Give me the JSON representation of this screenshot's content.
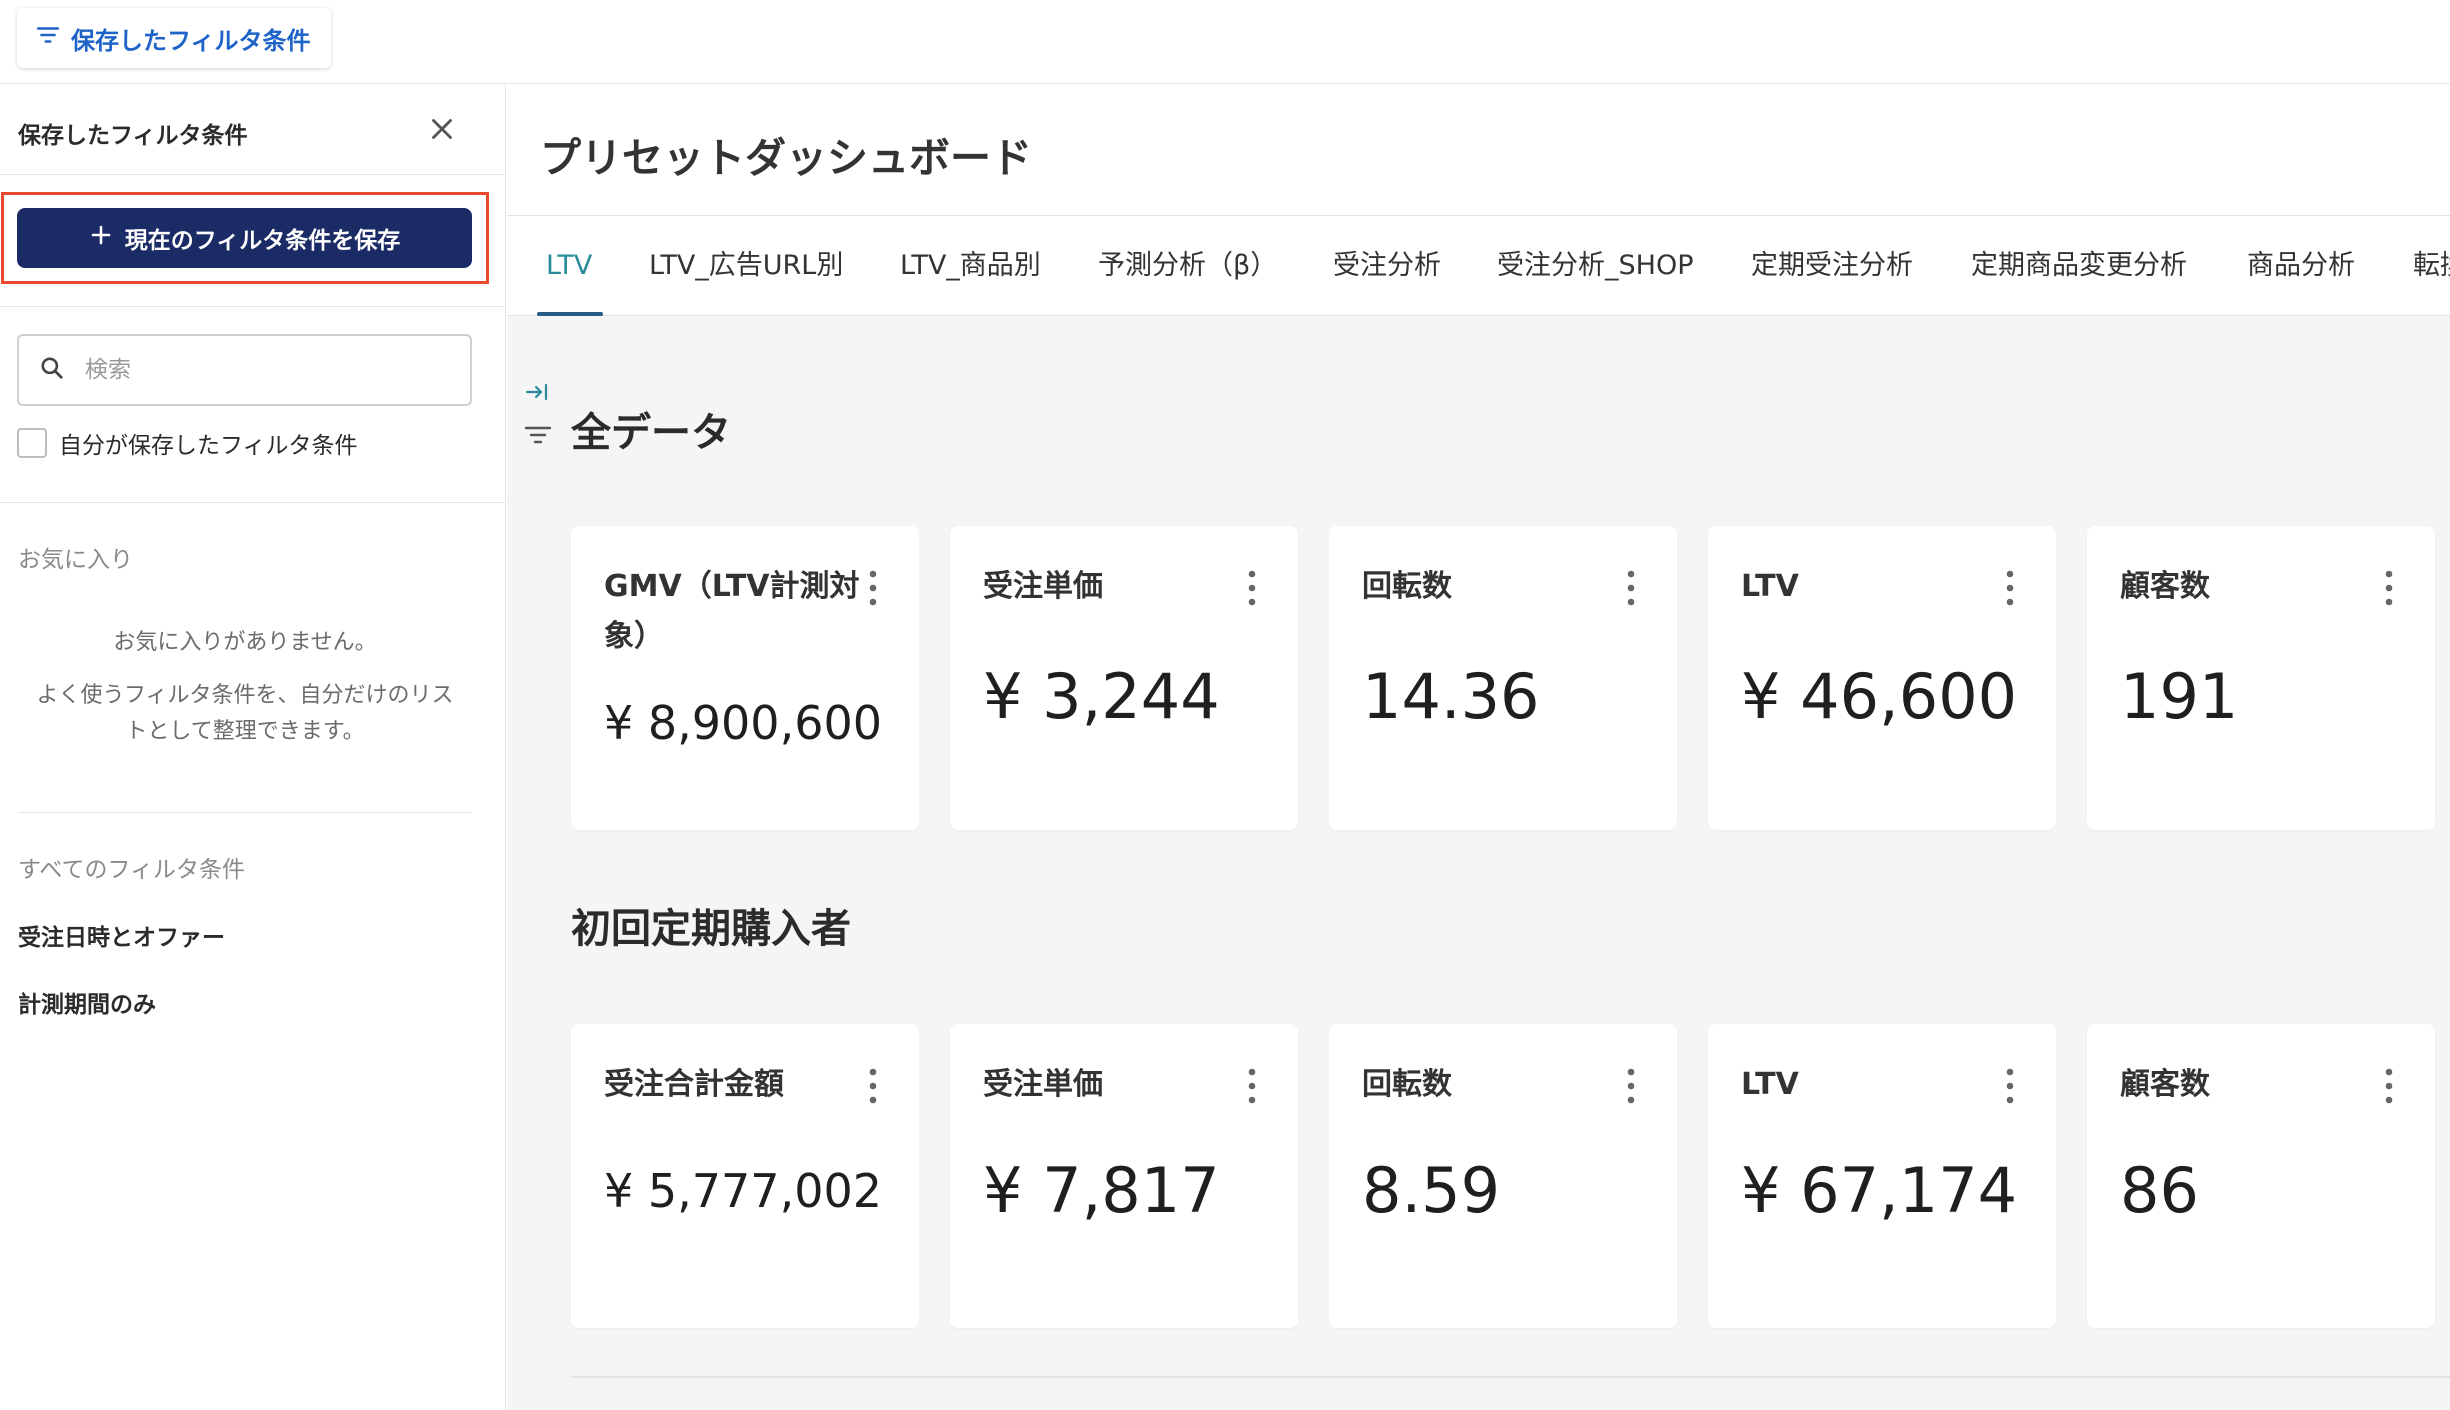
{
  "top_bar": {
    "saved_filters_button": "保存したフィルタ条件"
  },
  "sidebar": {
    "title": "保存したフィルタ条件",
    "save_current_button": "現在のフィルタ条件を保存",
    "search_placeholder": "検索",
    "only_mine_label": "自分が保存したフィルタ条件",
    "favorites_label": "お気に入り",
    "favorites_empty": "お気に入りがありません。",
    "favorites_hint": "よく使うフィルタ条件を、自分だけのリストとして整理できます。",
    "all_filters_label": "すべてのフィルタ条件",
    "filters": [
      "受注日時とオファー",
      "計測期間のみ"
    ]
  },
  "main": {
    "page_title": "プリセットダッシュボード",
    "tabs": [
      "LTV",
      "LTV_広告URL別",
      "LTV_商品別",
      "予測分析（β）",
      "受注分析",
      "受注分析_SHOP",
      "定期受注分析",
      "定期商品変更分析",
      "商品分析",
      "転換"
    ],
    "active_tab": "LTV",
    "sections": [
      {
        "title": "全データ",
        "cards": [
          {
            "title": "GMV（LTV計測対象）",
            "value": "¥ 8,900,600"
          },
          {
            "title": "受注単価",
            "value": "¥ 3,244"
          },
          {
            "title": "回転数",
            "value": "14.36"
          },
          {
            "title": "LTV",
            "value": "¥ 46,600"
          },
          {
            "title": "顧客数",
            "value": "191"
          }
        ]
      },
      {
        "title": "初回定期購入者",
        "cards": [
          {
            "title": "受注合計金額",
            "value": "¥ 5,777,002"
          },
          {
            "title": "受注単価",
            "value": "¥ 7,817"
          },
          {
            "title": "回転数",
            "value": "8.59"
          },
          {
            "title": "LTV",
            "value": "¥ 67,174"
          },
          {
            "title": "顧客数",
            "value": "86"
          }
        ]
      }
    ]
  },
  "colors": {
    "primary_button": "#1a2b66",
    "highlight_border": "#e8492f",
    "link_blue": "#1e63c8",
    "active_tab": "#2a8c9a"
  }
}
